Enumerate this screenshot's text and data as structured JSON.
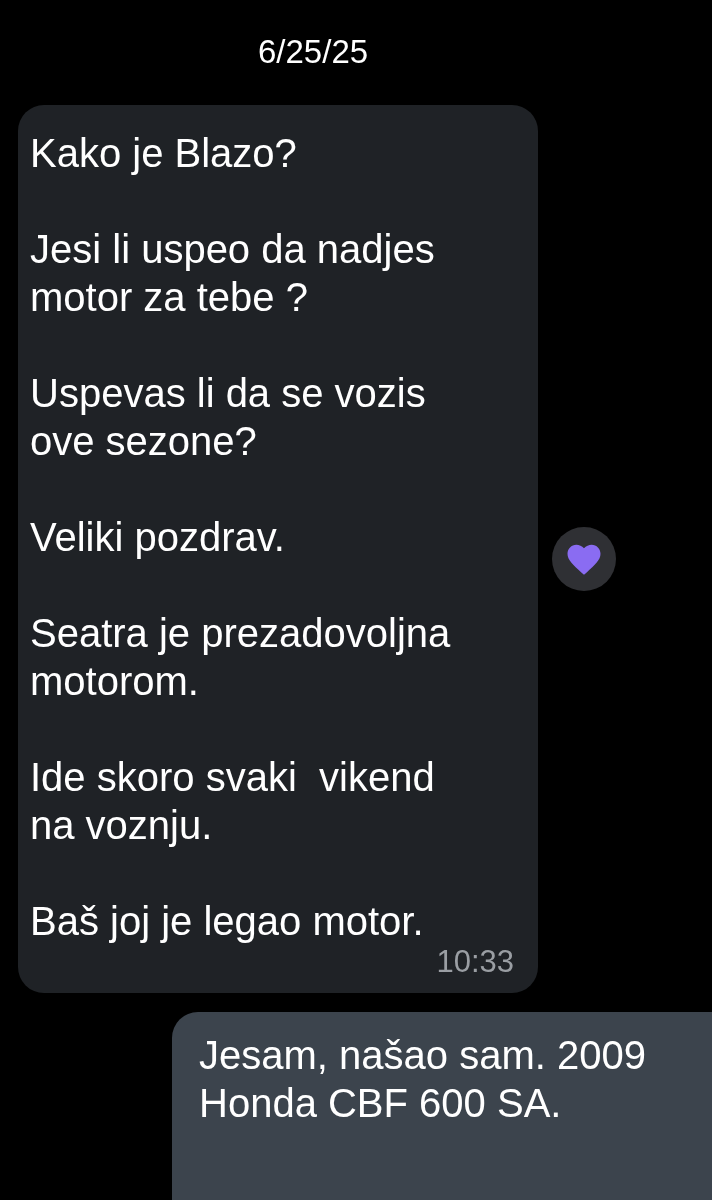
{
  "date": "6/25/25",
  "messages": [
    {
      "kind": "incoming",
      "text": "Kako je Blazo?\n\nJesi li uspeo da nadjes\nmotor za tebe ?\n\nUspevas li da se vozis\nove sezone?\n\nVeliki pozdrav.\n\nSeatra je prezadovoljna\nmotorom.\n\nIde skoro svaki  vikend\nna voznju.\n\nBaš joj je legao motor.",
      "time": "10:33",
      "reacted": true
    },
    {
      "kind": "outgoing",
      "text": "Jesam, našao sam. 2009\nHonda CBF 600 SA."
    }
  ]
}
